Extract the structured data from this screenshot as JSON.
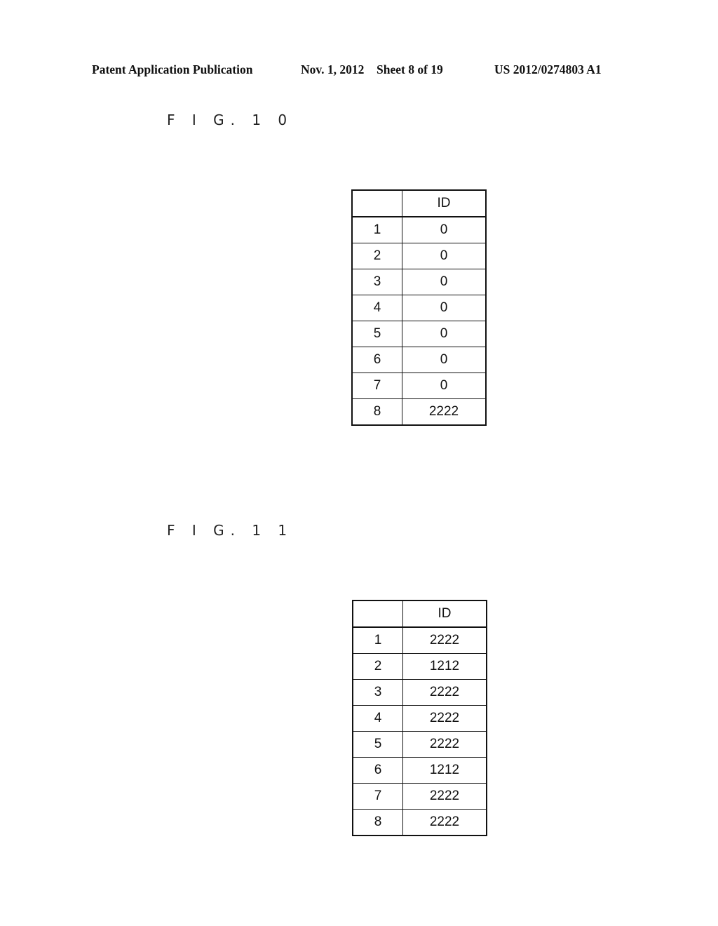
{
  "header": {
    "publication": "Patent Application Publication",
    "date": "Nov. 1, 2012",
    "sheet": "Sheet 8 of 19",
    "number": "US 2012/0274803 A1"
  },
  "figures": [
    {
      "label": "F I G. 1 0",
      "table": {
        "columns": [
          "",
          "ID"
        ],
        "rows": [
          {
            "index": "1",
            "id": "0"
          },
          {
            "index": "2",
            "id": "0"
          },
          {
            "index": "3",
            "id": "0"
          },
          {
            "index": "4",
            "id": "0"
          },
          {
            "index": "5",
            "id": "0"
          },
          {
            "index": "6",
            "id": "0"
          },
          {
            "index": "7",
            "id": "0"
          },
          {
            "index": "8",
            "id": "2222"
          }
        ]
      }
    },
    {
      "label": "F I G. 1 1",
      "table": {
        "columns": [
          "",
          "ID"
        ],
        "rows": [
          {
            "index": "1",
            "id": "2222"
          },
          {
            "index": "2",
            "id": "1212"
          },
          {
            "index": "3",
            "id": "2222"
          },
          {
            "index": "4",
            "id": "2222"
          },
          {
            "index": "5",
            "id": "2222"
          },
          {
            "index": "6",
            "id": "1212"
          },
          {
            "index": "7",
            "id": "2222"
          },
          {
            "index": "8",
            "id": "2222"
          }
        ]
      }
    }
  ]
}
